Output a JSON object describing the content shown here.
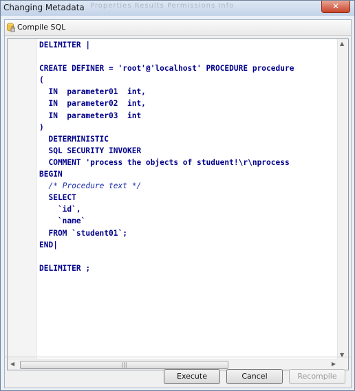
{
  "window": {
    "title": "Changing Metadata",
    "background_tabs": "Properties   Results   Permissions   Info",
    "close_label": "✕"
  },
  "toolbar": {
    "compile_label": "Compile SQL"
  },
  "editor": {
    "lines": [
      {
        "parts": [
          {
            "t": "DELIMITER |",
            "k": "kw"
          }
        ]
      },
      {
        "parts": []
      },
      {
        "parts": [
          {
            "t": "CREATE DEFINER = 'root'@'localhost' PROCEDURE procedure",
            "k": "kw"
          }
        ]
      },
      {
        "parts": [
          {
            "t": "(",
            "k": "kw"
          }
        ]
      },
      {
        "parts": [
          {
            "t": "  IN  parameter01  int,",
            "k": "kw"
          }
        ]
      },
      {
        "parts": [
          {
            "t": "  IN  parameter02  int,",
            "k": "kw"
          }
        ]
      },
      {
        "parts": [
          {
            "t": "  IN  parameter03  int",
            "k": "kw"
          }
        ]
      },
      {
        "parts": [
          {
            "t": ")",
            "k": "kw"
          }
        ]
      },
      {
        "parts": [
          {
            "t": "  DETERMINISTIC",
            "k": "kw"
          }
        ]
      },
      {
        "parts": [
          {
            "t": "  SQL SECURITY INVOKER",
            "k": "kw"
          }
        ]
      },
      {
        "parts": [
          {
            "t": "  COMMENT 'process the objects of studuent!\\r\\nprocess",
            "k": "kw"
          }
        ]
      },
      {
        "parts": [
          {
            "t": "BEGIN",
            "k": "kw"
          }
        ]
      },
      {
        "parts": [
          {
            "t": "  ",
            "k": ""
          },
          {
            "t": "/* Procedure text */",
            "k": "cm"
          }
        ]
      },
      {
        "parts": [
          {
            "t": "  SELECT",
            "k": "kw"
          }
        ]
      },
      {
        "parts": [
          {
            "t": "    `id`,",
            "k": "kw"
          }
        ]
      },
      {
        "parts": [
          {
            "t": "    `name`",
            "k": "kw"
          }
        ]
      },
      {
        "parts": [
          {
            "t": "  FROM `student01`;",
            "k": "kw"
          }
        ]
      },
      {
        "parts": [
          {
            "t": "END|",
            "k": "kw"
          }
        ]
      },
      {
        "parts": []
      },
      {
        "parts": [
          {
            "t": "DELIMITER ;",
            "k": "kw"
          }
        ]
      }
    ]
  },
  "buttons": {
    "execute": "Execute",
    "cancel": "Cancel",
    "recompile": "Recompile"
  },
  "colors": {
    "keyword": "#00008b",
    "comment": "#1c2fb0"
  }
}
